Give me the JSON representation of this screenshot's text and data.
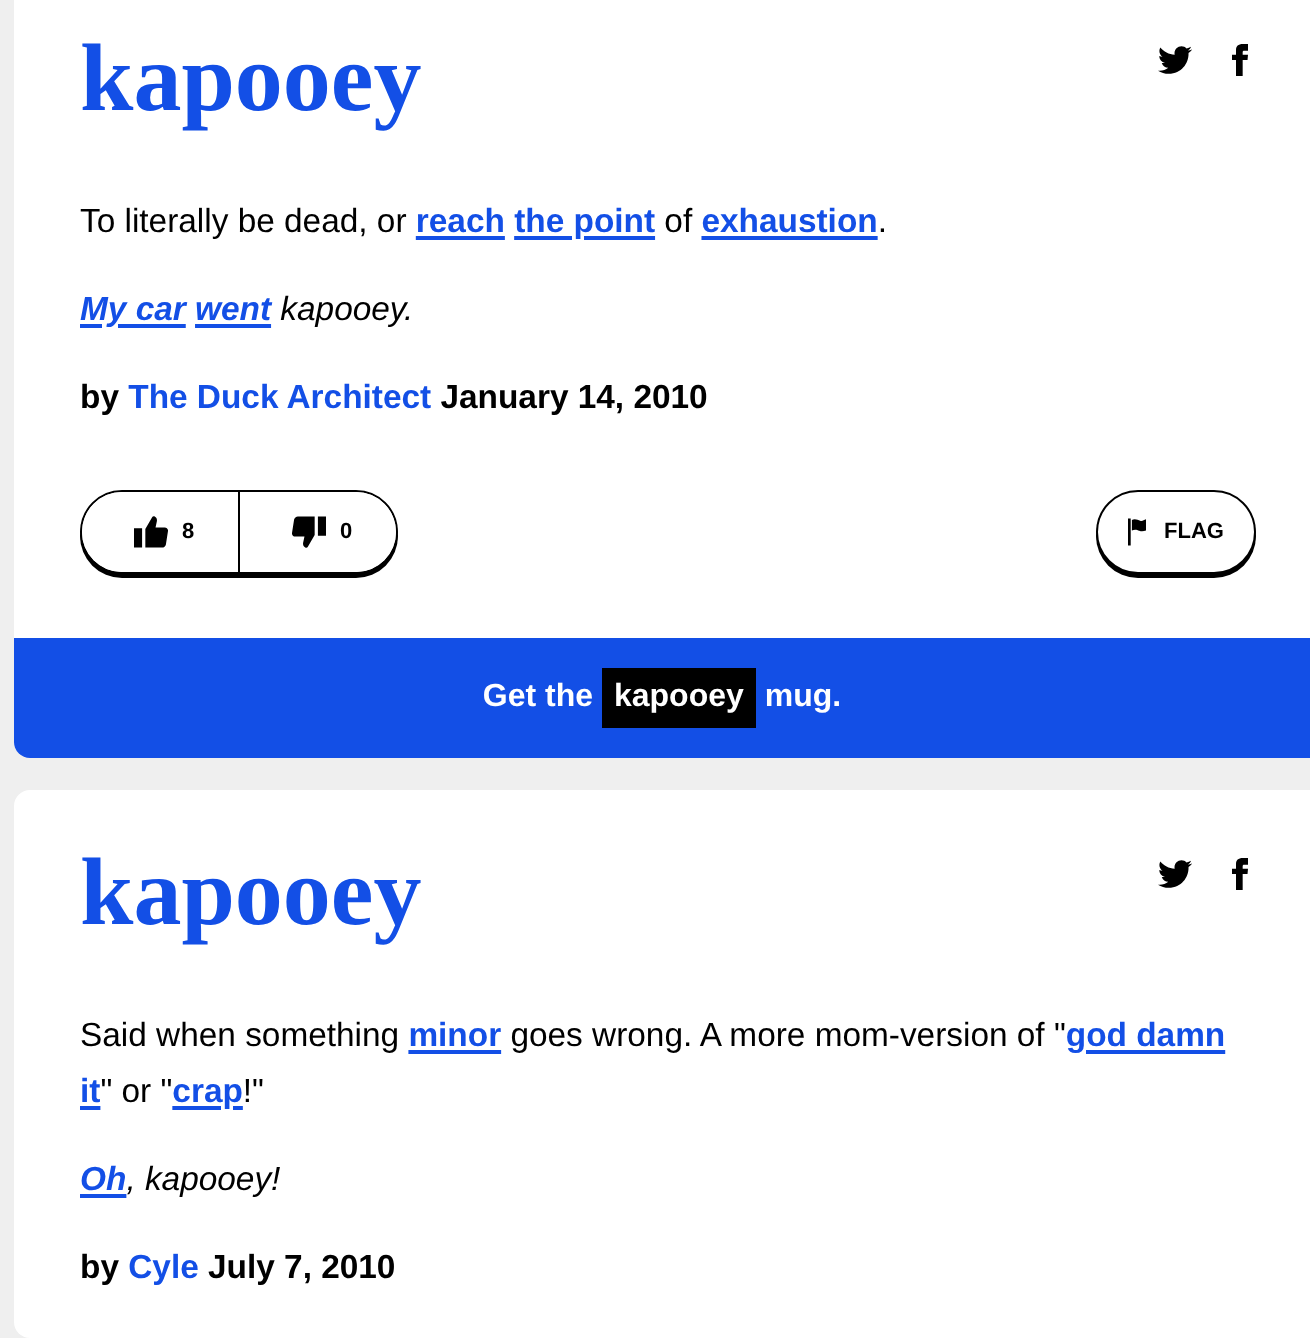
{
  "entries": [
    {
      "word": "kapooey",
      "definition": [
        {
          "kind": "text",
          "text": "To literally be dead, or "
        },
        {
          "kind": "link",
          "text": "reach"
        },
        {
          "kind": "link",
          "text": "the point"
        },
        {
          "kind": "text",
          "text": " of "
        },
        {
          "kind": "link",
          "text": "exhaustion"
        },
        {
          "kind": "text",
          "text": "."
        }
      ],
      "example": [
        {
          "kind": "link",
          "text": "My car"
        },
        {
          "kind": "link",
          "text": "went"
        },
        {
          "kind": "text",
          "text": " kapooey."
        }
      ],
      "byline": {
        "prefix": "by",
        "author": "The Duck Architect",
        "date": "January 14, 2010"
      },
      "votes": {
        "up": "8",
        "down": "0"
      },
      "flag": "FLAG",
      "promo": {
        "before": "Get the",
        "word": "kapooey",
        "after": "mug."
      }
    },
    {
      "word": "kapooey",
      "definition": [
        {
          "kind": "text",
          "text": "Said when something "
        },
        {
          "kind": "link",
          "text": "minor"
        },
        {
          "kind": "text",
          "text": " goes wrong. A more mom-version of \""
        },
        {
          "kind": "link",
          "text": "god damn"
        },
        {
          "kind": "link",
          "text": "it"
        },
        {
          "kind": "text",
          "text": "\" or \""
        },
        {
          "kind": "link",
          "text": "crap"
        },
        {
          "kind": "text",
          "text": "!\""
        }
      ],
      "example": [
        {
          "kind": "link",
          "text": "Oh"
        },
        {
          "kind": "text",
          "text": ", kapooey!"
        }
      ],
      "byline": {
        "prefix": "by",
        "author": "Cyle",
        "date": "July 7, 2010"
      }
    }
  ]
}
